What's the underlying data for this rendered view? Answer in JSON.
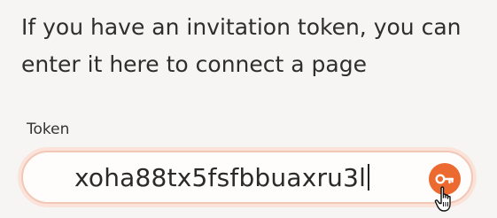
{
  "intro": {
    "text": "If you have an invitation token, you can enter it here to connect a page"
  },
  "token": {
    "label": "Token",
    "value": "xoha88tx5fsfbbuaxru3l"
  },
  "icons": {
    "submit": "key-icon",
    "cursor": "hand-pointer-icon"
  },
  "colors": {
    "accent": "#ec6a2f",
    "field_border": "#f1c7b6"
  }
}
